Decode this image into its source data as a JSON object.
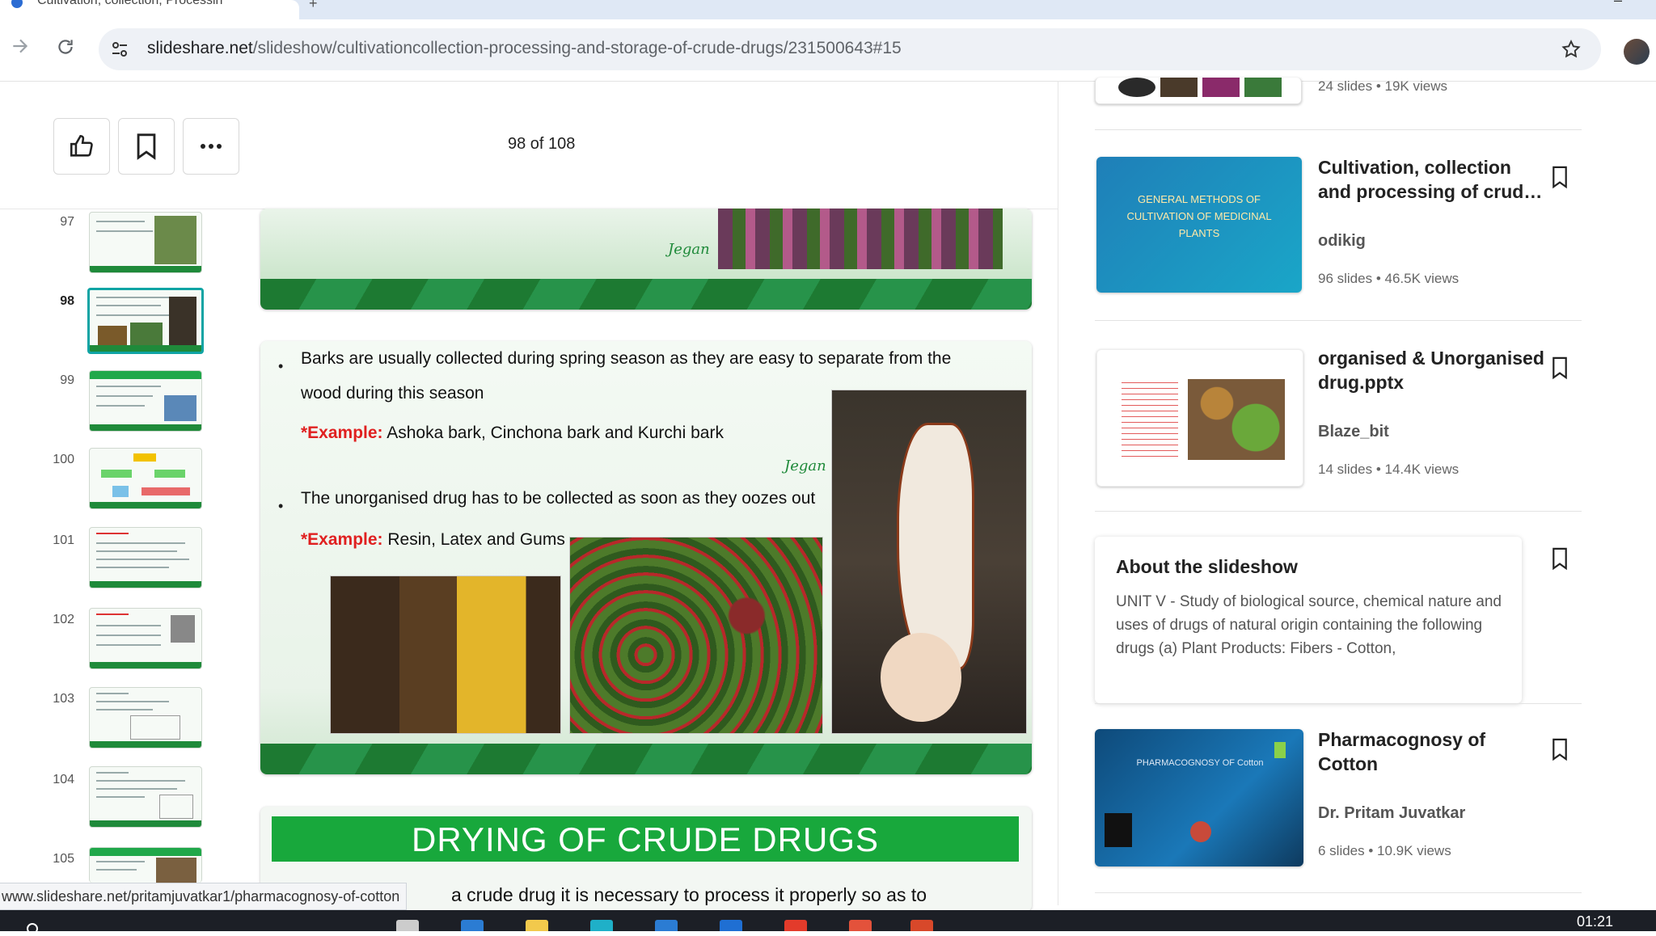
{
  "browser": {
    "tab_title": "Cultivation, collection, Processin",
    "url_host": "slideshare.net",
    "url_path": "/slideshow/cultivationcollection-processing-and-storage-of-crude-drugs/231500643#15",
    "status_url": "www.slideshare.net/pritamjuvatkar1/pharmacognosy-of-cotton"
  },
  "toolbar": {
    "pager": "98 of 108"
  },
  "thumbnails": [
    {
      "number": "97"
    },
    {
      "number": "98"
    },
    {
      "number": "99"
    },
    {
      "number": "100"
    },
    {
      "number": "101"
    },
    {
      "number": "102"
    },
    {
      "number": "103"
    },
    {
      "number": "104"
    },
    {
      "number": "105"
    }
  ],
  "slide_a": {
    "signature": "Jegan"
  },
  "slide_b": {
    "bullet1_line1": "Barks are usually collected during spring season as they are easy to separate from the",
    "bullet1_line2": "wood during this season",
    "example_label": "*Example:",
    "example1_text": " Ashoka bark, Cinchona bark and Kurchi bark",
    "signature": "Jegan",
    "bullet2": "The unorganised drug has to be collected as soon as they oozes out",
    "example2_text": " Resin, Latex and Gums"
  },
  "slide_c": {
    "title": "DRYING OF CRUDE DRUGS",
    "body_fragment": "a crude drug it is necessary to process it properly so as to"
  },
  "related": {
    "top_meta": "24 slides  •  19K views",
    "items": [
      {
        "title": "Cultivation, collection and processing of crud…",
        "author": "odikig",
        "meta": "96 slides  •  46.5K views",
        "thumb_title": "GENERAL METHODS OF CULTIVATION OF MEDICINAL PLANTS"
      },
      {
        "title": "organised & Unorganised drug.pptx",
        "author": "Blaze_bit",
        "meta": "14 slides  •  14.4K views"
      },
      {
        "title": "Pharmacognosy of Cotton",
        "author": "Dr. Pritam Juvatkar",
        "meta": "6 slides  •  10.9K views",
        "thumb_title": "PHARMACOGNOSY OF Cotton"
      }
    ]
  },
  "about": {
    "title": "About the slideshow",
    "body": "UNIT V - Study of biological source, chemical nature and uses of drugs of natural origin containing the following drugs (a) Plant Products: Fibers - Cotton,"
  },
  "taskbar": {
    "clock": "01:21"
  },
  "colors": {
    "slide_green": "#1d7a32",
    "title_green": "#18a83c",
    "example_red": "#e02020",
    "current_thumb_border": "#10a4a4"
  }
}
